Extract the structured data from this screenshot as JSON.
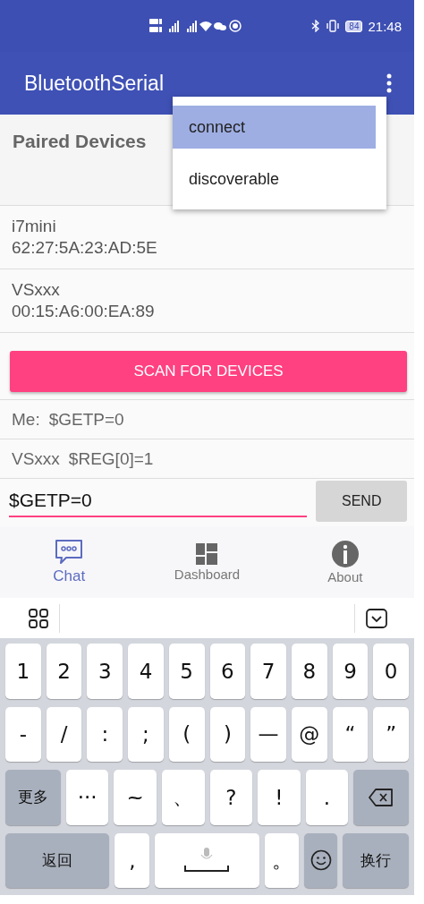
{
  "status_bar": {
    "battery": "84",
    "time": "21:48"
  },
  "app_bar": {
    "title": "BluetoothSerial"
  },
  "menu": [
    {
      "label": "connect",
      "selected": true
    },
    {
      "label": "discoverable",
      "selected": false
    }
  ],
  "paired_devices": {
    "title": "Paired Devices",
    "devices": [
      {
        "name": "i7mini",
        "address": "62:27:5A:23:AD:5E"
      },
      {
        "name": "VSxxx",
        "address": "00:15:A6:00:EA:89"
      }
    ]
  },
  "scan_button": "SCAN FOR DEVICES",
  "messages": [
    {
      "sender": "Me:",
      "text": "$GETP=0"
    },
    {
      "sender": "VSxxx",
      "text": "$REG[0]=1"
    }
  ],
  "input": {
    "value": "$GETP=0",
    "send": "SEND"
  },
  "bottom_nav": [
    {
      "label": "Chat",
      "kind": "chat",
      "selected": true
    },
    {
      "label": "Dashboard",
      "kind": "dashboard",
      "selected": false
    },
    {
      "label": "About",
      "kind": "about",
      "selected": false
    }
  ],
  "keyboard": [
    [
      {
        "kind": "key",
        "label": "1"
      },
      {
        "kind": "key",
        "label": "2"
      },
      {
        "kind": "key",
        "label": "3"
      },
      {
        "kind": "key",
        "label": "4"
      },
      {
        "kind": "key",
        "label": "5"
      },
      {
        "kind": "key",
        "label": "6"
      },
      {
        "kind": "key",
        "label": "7"
      },
      {
        "kind": "key",
        "label": "8"
      },
      {
        "kind": "key",
        "label": "9"
      },
      {
        "kind": "key",
        "label": "0"
      }
    ],
    [
      {
        "kind": "key",
        "label": "-"
      },
      {
        "kind": "key",
        "label": "/"
      },
      {
        "kind": "key",
        "label": ":"
      },
      {
        "kind": "key",
        "label": ";"
      },
      {
        "kind": "key",
        "label": "("
      },
      {
        "kind": "key",
        "label": ")"
      },
      {
        "kind": "key",
        "label": "—"
      },
      {
        "kind": "key",
        "label": "@"
      },
      {
        "kind": "key",
        "label": "“"
      },
      {
        "kind": "key",
        "label": "”"
      }
    ],
    [
      {
        "kind": "func",
        "label": "更多"
      },
      {
        "kind": "key",
        "label": "···"
      },
      {
        "kind": "key",
        "label": "~"
      },
      {
        "kind": "key",
        "label": "、"
      },
      {
        "kind": "key",
        "label": "?"
      },
      {
        "kind": "key",
        "label": "!"
      },
      {
        "kind": "key",
        "label": "."
      },
      {
        "kind": "backspace"
      }
    ],
    [
      {
        "kind": "wide",
        "label": "返回"
      },
      {
        "kind": "key",
        "label": ","
      },
      {
        "kind": "space"
      },
      {
        "kind": "key",
        "label": "。"
      },
      {
        "kind": "emoji"
      },
      {
        "kind": "enter",
        "label": "换行"
      }
    ]
  ]
}
